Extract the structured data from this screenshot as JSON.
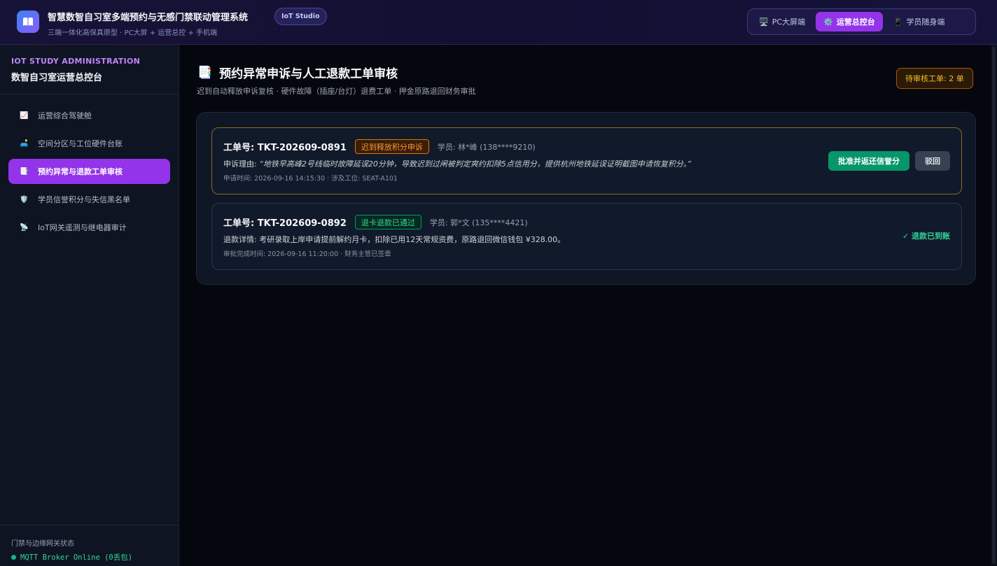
{
  "header": {
    "logo_icon": "book-icon",
    "title": "智慧数智自习室多端预约与无感门禁联动管理系统",
    "subtitle": "三端一体化高保真原型 · PC大屏 + 运营总控 + 手机端",
    "badge": "IoT Studio",
    "views": [
      {
        "icon": "monitor-icon",
        "label": "PC大屏端",
        "active": false
      },
      {
        "icon": "gear-icon",
        "label": "运营总控台",
        "active": true
      },
      {
        "icon": "phone-icon",
        "label": "学员随身端",
        "active": false
      }
    ]
  },
  "sidebar": {
    "eyebrow": "IOT STUDY ADMINISTRATION",
    "title": "数智自习室运营总控台",
    "items": [
      {
        "icon": "chart-icon",
        "label": "运营综合驾驶舱",
        "active": false
      },
      {
        "icon": "seat-icon",
        "label": "空间分区与工位硬件台账",
        "active": false
      },
      {
        "icon": "document-icon",
        "label": "预约异常与退款工单审核",
        "active": true
      },
      {
        "icon": "shield-icon",
        "label": "学员信誉积分与失信黑名单",
        "active": false
      },
      {
        "icon": "antenna-icon",
        "label": "IoT网关遥测与继电器审计",
        "active": false
      }
    ],
    "footer_label": "门禁与边缘网关状态",
    "footer_status": "MQTT Broker Online (0丢包)",
    "status_color": "#10b981"
  },
  "main": {
    "title_icon": "document-icon",
    "title": "预约异常申诉与人工退款工单审核",
    "subtitle": "迟到自动释放申诉复核 · 硬件故障（插座/台灯）退费工单 · 押金原路退回财务审批",
    "pending_badge": "待审核工单: 2 单",
    "tickets": [
      {
        "id": "工单号: TKT-202609-0891",
        "tag": "迟到释放积分申诉",
        "tag_status": "warning",
        "user": "学员: 林*峰 (138****9210)",
        "body_label": "申诉理由: ",
        "body_text": "“地铁早高峰2号线临时故障延误20分钟，导致迟到过闸被判定爽约扣除5点信用分，提供杭州地铁延误证明截图申请恢复积分。”",
        "meta": "申请时间: 2026-09-16 14:15:30 · 涉及工位: SEAT-A101",
        "approve_label": "批准并返还信誉分",
        "reject_label": "驳回"
      },
      {
        "id": "工单号: TKT-202609-0892",
        "tag": "退卡退款已通过",
        "tag_status": "success",
        "user": "学员: 郭*文 (135****4421)",
        "body_label": "退款详情: ",
        "body_text": "考研录取上岸申请提前解约月卡，扣除已用12天常规资费，原路退回微信钱包 ¥328.00。",
        "meta": "审批完成时间: 2026-09-16 11:20:00 · 财务主管已签章",
        "done_label": "✓ 退款已到账"
      }
    ]
  },
  "colors": {
    "accent": "#9333ea",
    "success": "#059669",
    "warning": "#d97706"
  }
}
